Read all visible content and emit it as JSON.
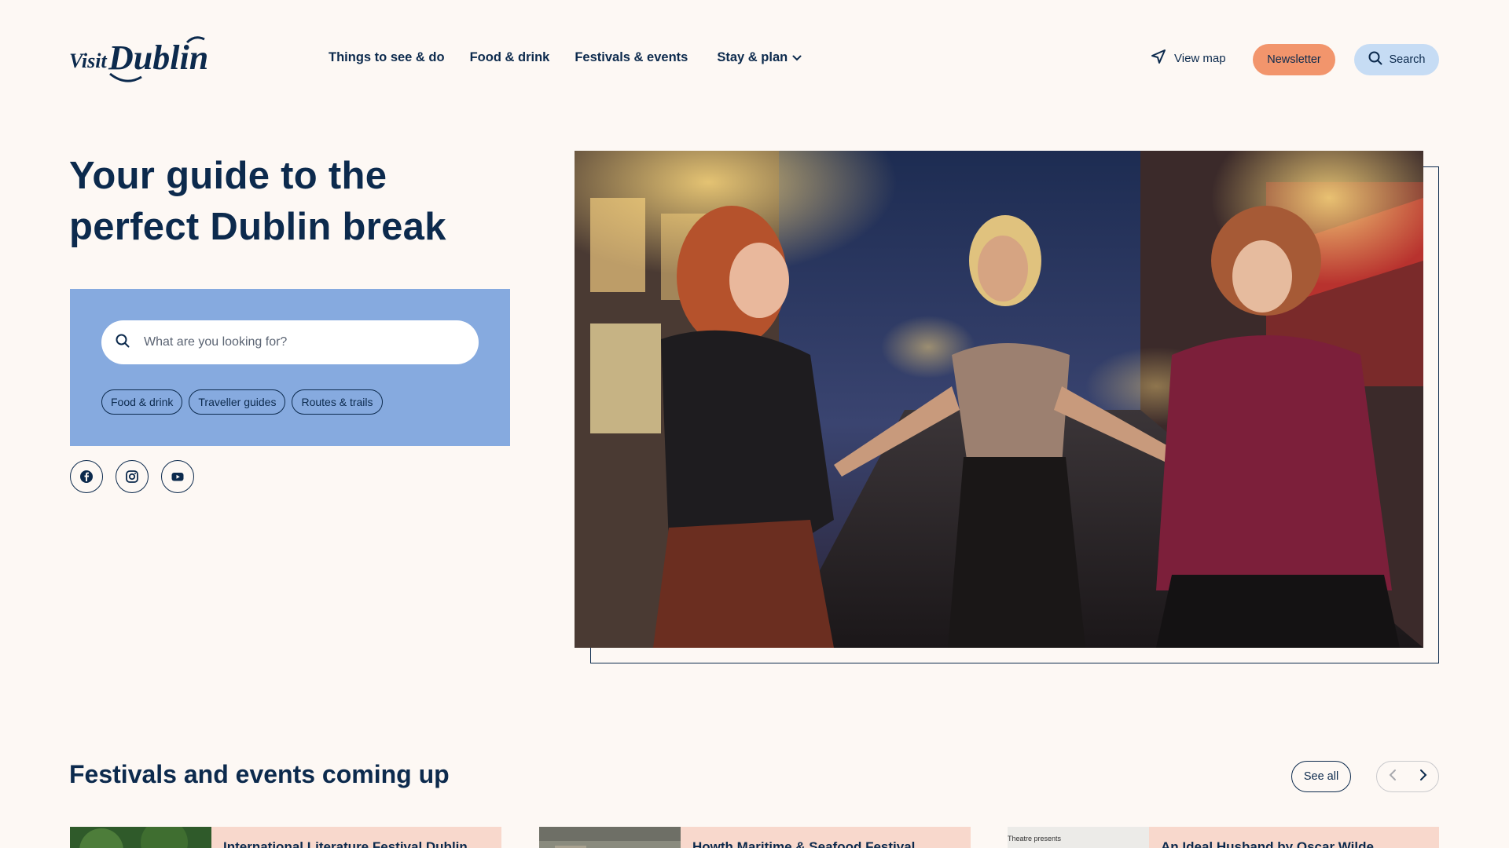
{
  "brand": {
    "logo_text": "Visit Dublin",
    "navy": "#0c2a4d",
    "accent": "#f2956c",
    "panel_blue": "#86aadf"
  },
  "nav": {
    "items": [
      {
        "label": "Things to see & do"
      },
      {
        "label": "Food & drink"
      },
      {
        "label": "Festivals & events"
      },
      {
        "label": "Stay & plan"
      }
    ]
  },
  "header_actions": {
    "view_map": "View map",
    "newsletter": "Newsletter",
    "search": "Search"
  },
  "hero": {
    "title_line1": "Your guide to the",
    "title_line2": "perfect Dublin break",
    "search_placeholder": "What are you looking for?",
    "chips": [
      "Food & drink",
      "Traveller guides",
      "Routes & trails"
    ],
    "socials": [
      "facebook-icon",
      "instagram-icon",
      "youtube-icon"
    ]
  },
  "events": {
    "title": "Festivals and events coming up",
    "see_all": "See all",
    "cards": [
      {
        "title": "International Literature Festival Dublin"
      },
      {
        "title": "Howth Maritime & Seafood Festival"
      },
      {
        "title": "An Ideal Husband by Oscar Wilde",
        "image_caption": "Theatre presents"
      }
    ]
  }
}
